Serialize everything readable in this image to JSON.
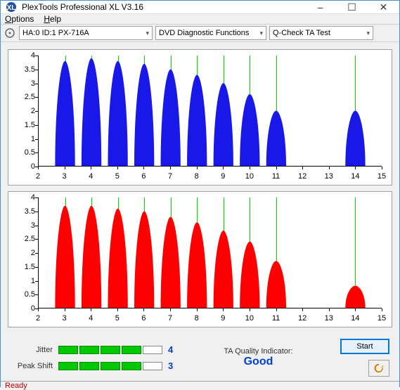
{
  "window": {
    "title": "PlexTools Professional XL V3.16",
    "min_label": "–",
    "max_label": "☐",
    "close_label": "✕"
  },
  "menu": {
    "options": "Options",
    "help": "Help"
  },
  "toolbar": {
    "device": "HA:0 ID:1   PX-716A",
    "func": "DVD Diagnostic Functions",
    "test": "Q-Check TA Test"
  },
  "yticks": [
    "0",
    "0.5",
    "1",
    "1.5",
    "2",
    "2.5",
    "3",
    "3.5",
    "4"
  ],
  "xticks": [
    "2",
    "3",
    "4",
    "5",
    "6",
    "7",
    "8",
    "9",
    "10",
    "11",
    "12",
    "13",
    "14",
    "15"
  ],
  "chart_data": [
    {
      "type": "bar",
      "title": "",
      "xlabel": "",
      "ylabel": "",
      "ylim": [
        0,
        4
      ],
      "xlim": [
        2,
        15
      ],
      "color": "#1818e8",
      "grid_vlines": [
        3,
        4,
        5,
        6,
        7,
        8,
        9,
        10,
        11,
        14
      ],
      "categories": [
        3,
        4,
        5,
        6,
        7,
        8,
        9,
        10,
        11,
        14
      ],
      "values": [
        3.8,
        3.9,
        3.8,
        3.7,
        3.5,
        3.3,
        3.0,
        2.6,
        2.0,
        2.0
      ]
    },
    {
      "type": "bar",
      "title": "",
      "xlabel": "",
      "ylabel": "",
      "ylim": [
        0,
        4
      ],
      "xlim": [
        2,
        15
      ],
      "color": "#ff0000",
      "grid_vlines": [
        3,
        4,
        5,
        6,
        7,
        8,
        9,
        10,
        11,
        14
      ],
      "categories": [
        3,
        4,
        5,
        6,
        7,
        8,
        9,
        10,
        11,
        14
      ],
      "values": [
        3.7,
        3.7,
        3.6,
        3.5,
        3.3,
        3.1,
        2.8,
        2.4,
        1.7,
        0.8
      ]
    }
  ],
  "meters": {
    "jitter": {
      "label": "Jitter",
      "value": "4",
      "bars_on": 4,
      "bars_total": 5
    },
    "peakshift": {
      "label": "Peak Shift",
      "value": "3",
      "bars_on": 4,
      "bars_total": 5
    }
  },
  "quality": {
    "label": "TA Quality Indicator:",
    "value": "Good"
  },
  "buttons": {
    "start": "Start"
  },
  "status": "Ready"
}
